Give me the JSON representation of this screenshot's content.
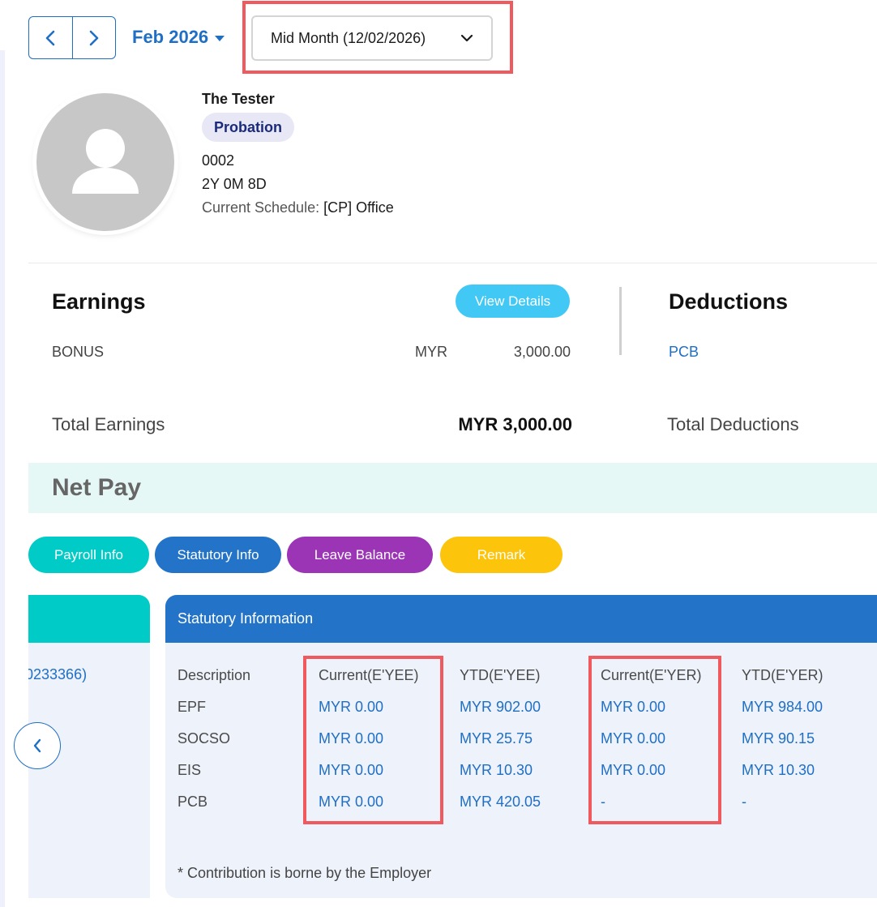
{
  "header": {
    "month": "Feb 2026",
    "period": "Mid Month (12/02/2026)"
  },
  "profile": {
    "name": "The Tester",
    "status": "Probation",
    "employee_id": "0002",
    "tenure": "2Y 0M 8D",
    "schedule_label": "Current Schedule:",
    "schedule_value": "[CP] Office"
  },
  "earnings": {
    "title": "Earnings",
    "view_details": "View Details",
    "items": [
      {
        "name": "BONUS",
        "currency": "MYR",
        "amount": "3,000.00"
      }
    ],
    "total_label": "Total Earnings",
    "total_value": "MYR 3,000.00"
  },
  "deductions": {
    "title": "Deductions",
    "items": [
      {
        "name": "PCB"
      }
    ],
    "total_label": "Total Deductions"
  },
  "net_pay": {
    "label": "Net Pay"
  },
  "tabs": [
    {
      "label": "Payroll Info",
      "color": "#00cbc6"
    },
    {
      "label": "Statutory Info",
      "color": "#2374c8"
    },
    {
      "label": "Leave Balance",
      "color": "#9b35b5"
    },
    {
      "label": "Remark",
      "color": "#fcc40b"
    }
  ],
  "payroll_card": {
    "partial_value": "0233366)"
  },
  "statutory": {
    "title": "Statutory Information",
    "columns": [
      "Description",
      "Current(E'YEE)",
      "YTD(E'YEE)",
      "Current(E'YER)",
      "YTD(E'YER)"
    ],
    "rows": [
      [
        "EPF",
        "MYR 0.00",
        "MYR 902.00",
        "MYR 0.00",
        "MYR 984.00"
      ],
      [
        "SOCSO",
        "MYR 0.00",
        "MYR 25.75",
        "MYR 0.00",
        "MYR 90.15"
      ],
      [
        "EIS",
        "MYR 0.00",
        "MYR 10.30",
        "MYR 0.00",
        "MYR 10.30"
      ],
      [
        "PCB",
        "MYR 0.00",
        "MYR 420.05",
        "-",
        "-"
      ]
    ],
    "footnote": "* Contribution is borne by the Employer"
  },
  "colors": {
    "primary": "#1f6fc4",
    "highlight": "#f05a5e",
    "view_details": "#42c8f4",
    "net_pay_bg": "#e6f8f5"
  }
}
